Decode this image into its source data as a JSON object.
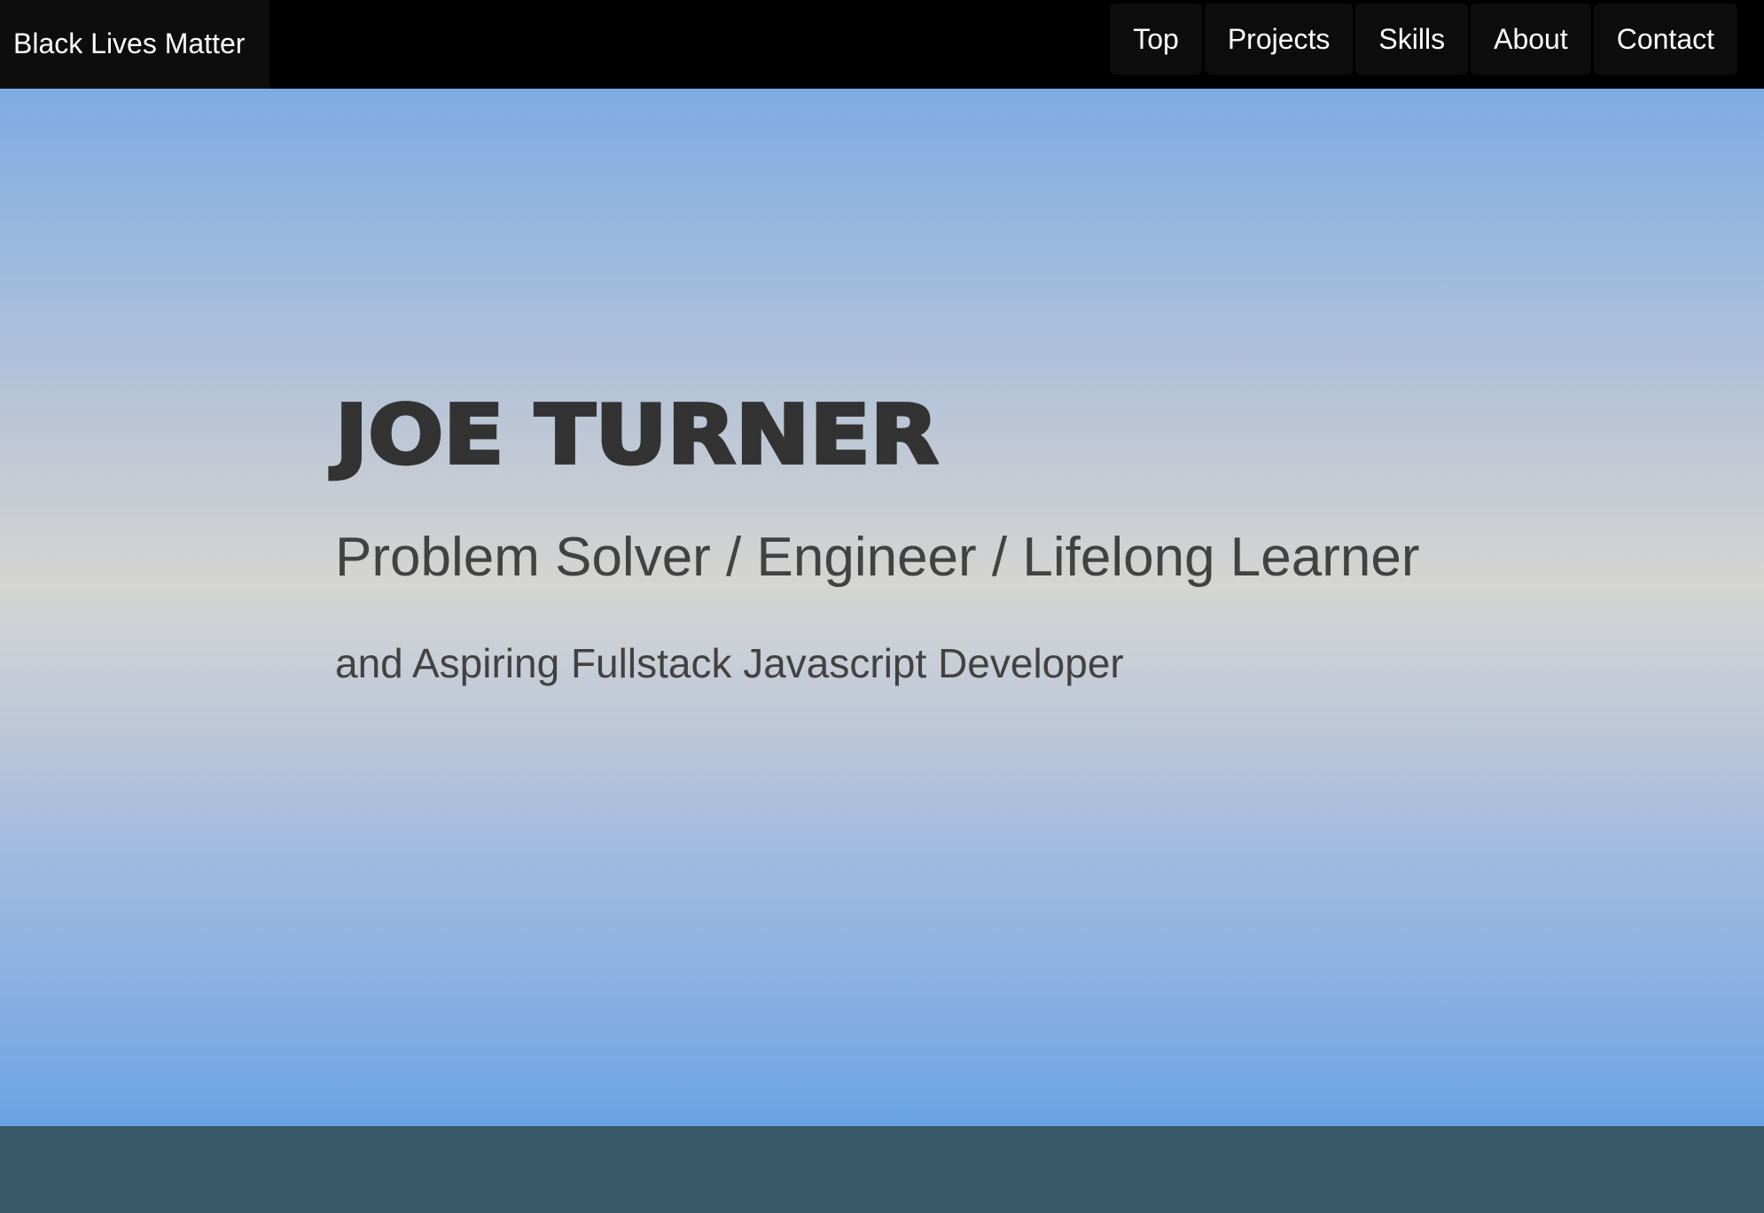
{
  "navbar": {
    "brand": "Black Lives Matter",
    "links": [
      {
        "label": "Top"
      },
      {
        "label": "Projects"
      },
      {
        "label": "Skills"
      },
      {
        "label": "About"
      },
      {
        "label": "Contact"
      }
    ]
  },
  "hero": {
    "name": "JOE TURNER",
    "tagline": "Problem Solver / Engineer / Lifelong Learner",
    "subtitle": "and Aspiring Fullstack Javascript Developer"
  },
  "colors": {
    "navbar_background": "#000000",
    "nav_button_background": "#0d0d0d",
    "hero_gradient_top": "#7dabe3",
    "hero_gradient_middle": "#d5d5d1",
    "hero_gradient_bottom": "#6aa3e4",
    "hero_text": "#333333",
    "footer_band": "#385869"
  }
}
